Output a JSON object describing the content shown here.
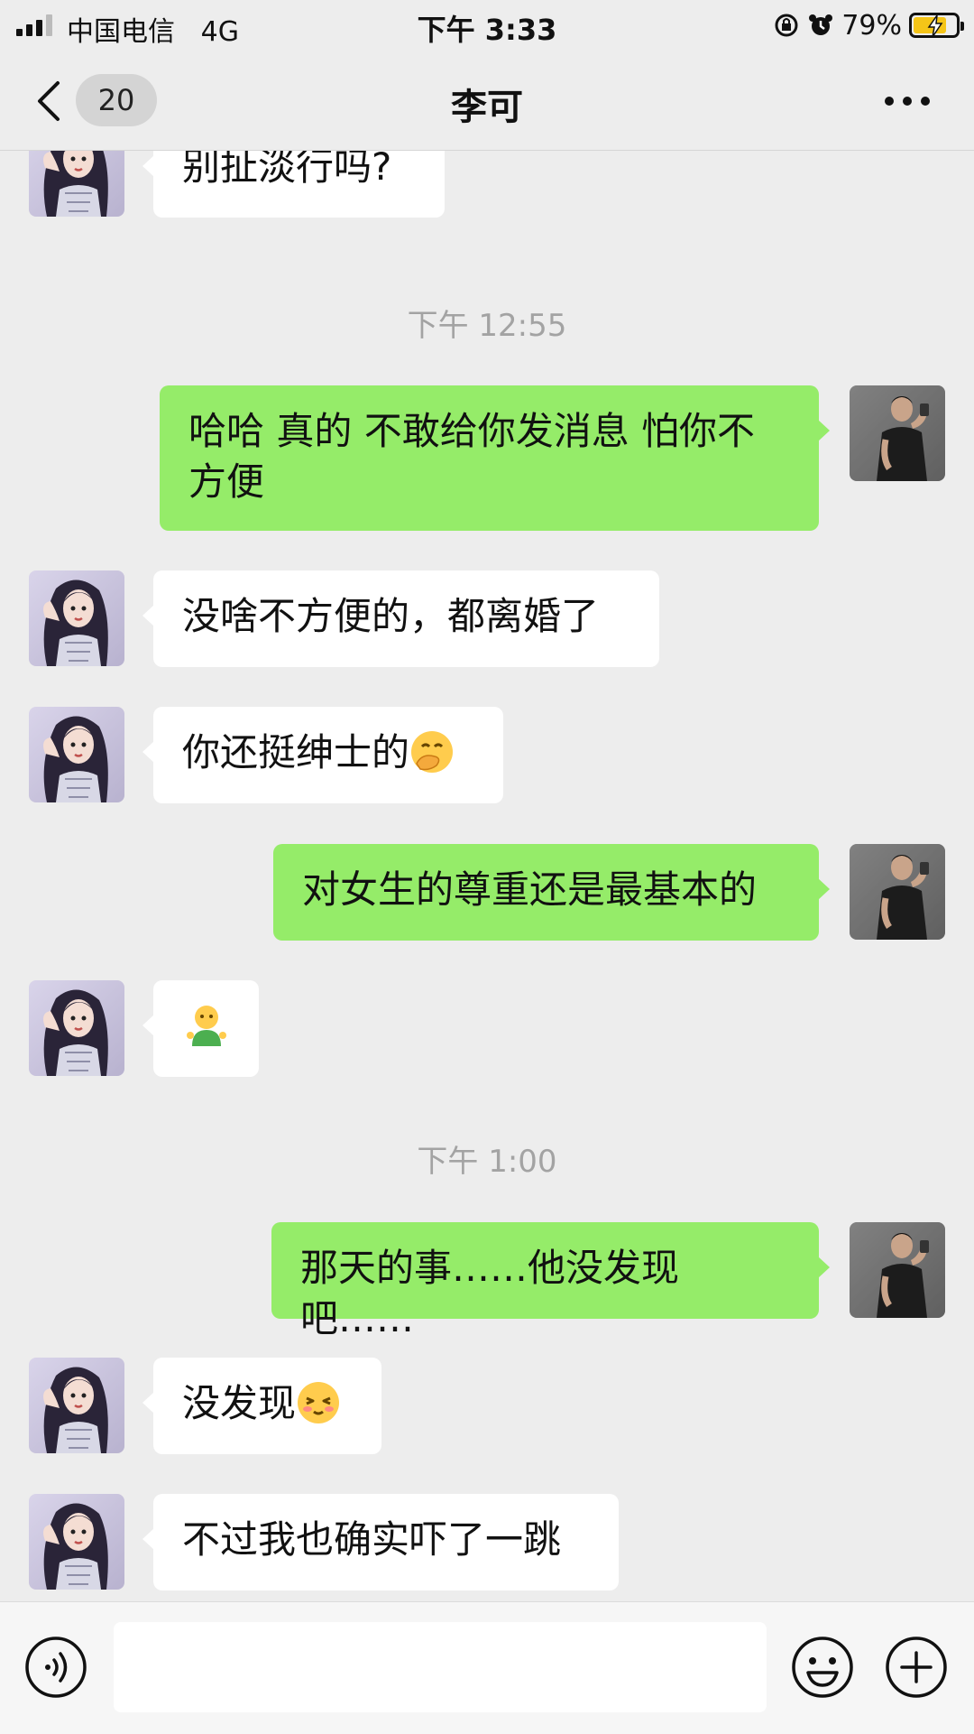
{
  "status_bar": {
    "carrier": "中国电信",
    "network": "4G",
    "time": "下午 3:33",
    "battery_percent": "79%",
    "battery_level": 0.79
  },
  "nav": {
    "unread_count": "20",
    "title": "李可"
  },
  "messages": [
    {
      "side": "in",
      "text": "别扯淡行吗?"
    },
    {
      "type": "time",
      "text": "下午 12:55"
    },
    {
      "side": "out",
      "text": "哈哈 真的 不敢给你发消息 怕你不方便"
    },
    {
      "side": "in",
      "text": "没啥不方便的，都离婚了"
    },
    {
      "side": "in",
      "text": "你还挺绅士的",
      "emoji": "hand-over-mouth-emoji"
    },
    {
      "side": "out",
      "text": "对女生的尊重还是最基本的"
    },
    {
      "side": "in",
      "text": "",
      "emoji": "shrug-person-emoji"
    },
    {
      "type": "time",
      "text": "下午 1:00"
    },
    {
      "side": "out",
      "text": "那天的事……他没发现吧……"
    },
    {
      "side": "in",
      "text": "没发现",
      "emoji": "squinting-blush-emoji"
    },
    {
      "side": "in",
      "text": "不过我也确实吓了一跳"
    }
  ],
  "input": {
    "placeholder": ""
  },
  "colors": {
    "background": "#ededed",
    "outgoing_bubble": "#95ec69",
    "incoming_bubble": "#ffffff",
    "timestamp": "#a3a3a3",
    "battery_fill": "#f5c518"
  },
  "icons": {
    "back": "chevron-left-icon",
    "more": "more-dots-icon",
    "voice": "voice-icon",
    "emoji": "smiley-icon",
    "plus": "plus-circle-icon"
  }
}
